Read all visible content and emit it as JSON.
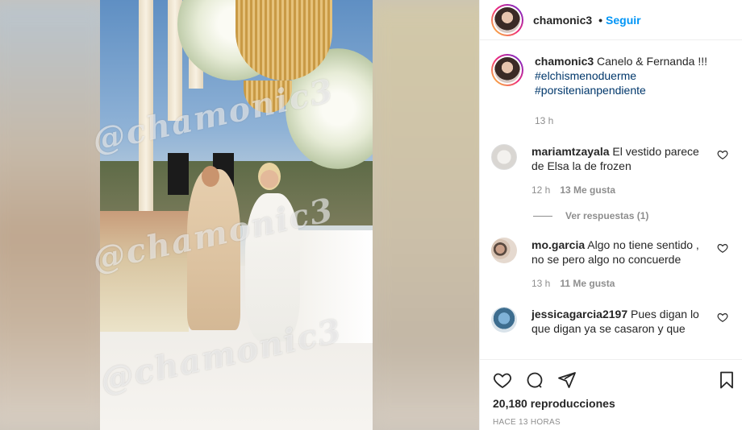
{
  "post": {
    "username": "chamonic3",
    "follow_label": "Seguir",
    "separator": "•",
    "watermark": "@chamonic3"
  },
  "caption": {
    "username": "chamonic3",
    "text": "Canelo & Fernanda !!!",
    "hashtags": [
      "#elchismenoduerme",
      "#porsitenianpendiente"
    ],
    "time": "13 h"
  },
  "comments": [
    {
      "username": "mariamtzayala",
      "text": "El vestido parece de Elsa la de frozen",
      "time": "12 h",
      "likes": "13 Me gusta",
      "replies": "Ver respuestas (1)"
    },
    {
      "username": "mo.garcia",
      "text": "Algo no tiene sentido , no se pero algo no concuerde",
      "time": "13 h",
      "likes": "11 Me gusta"
    },
    {
      "username": "jessicagarcia2197",
      "text": "Pues digan lo que digan ya se casaron y que"
    }
  ],
  "footer": {
    "views": "20,180 reproducciones",
    "posted_ago": "HACE 13 HORAS"
  },
  "icons": [
    "heart-icon",
    "comment-icon",
    "share-icon",
    "bookmark-icon"
  ],
  "colors": {
    "link": "#0095f6",
    "hashtag": "#00376b",
    "muted": "#8e8e8e"
  }
}
